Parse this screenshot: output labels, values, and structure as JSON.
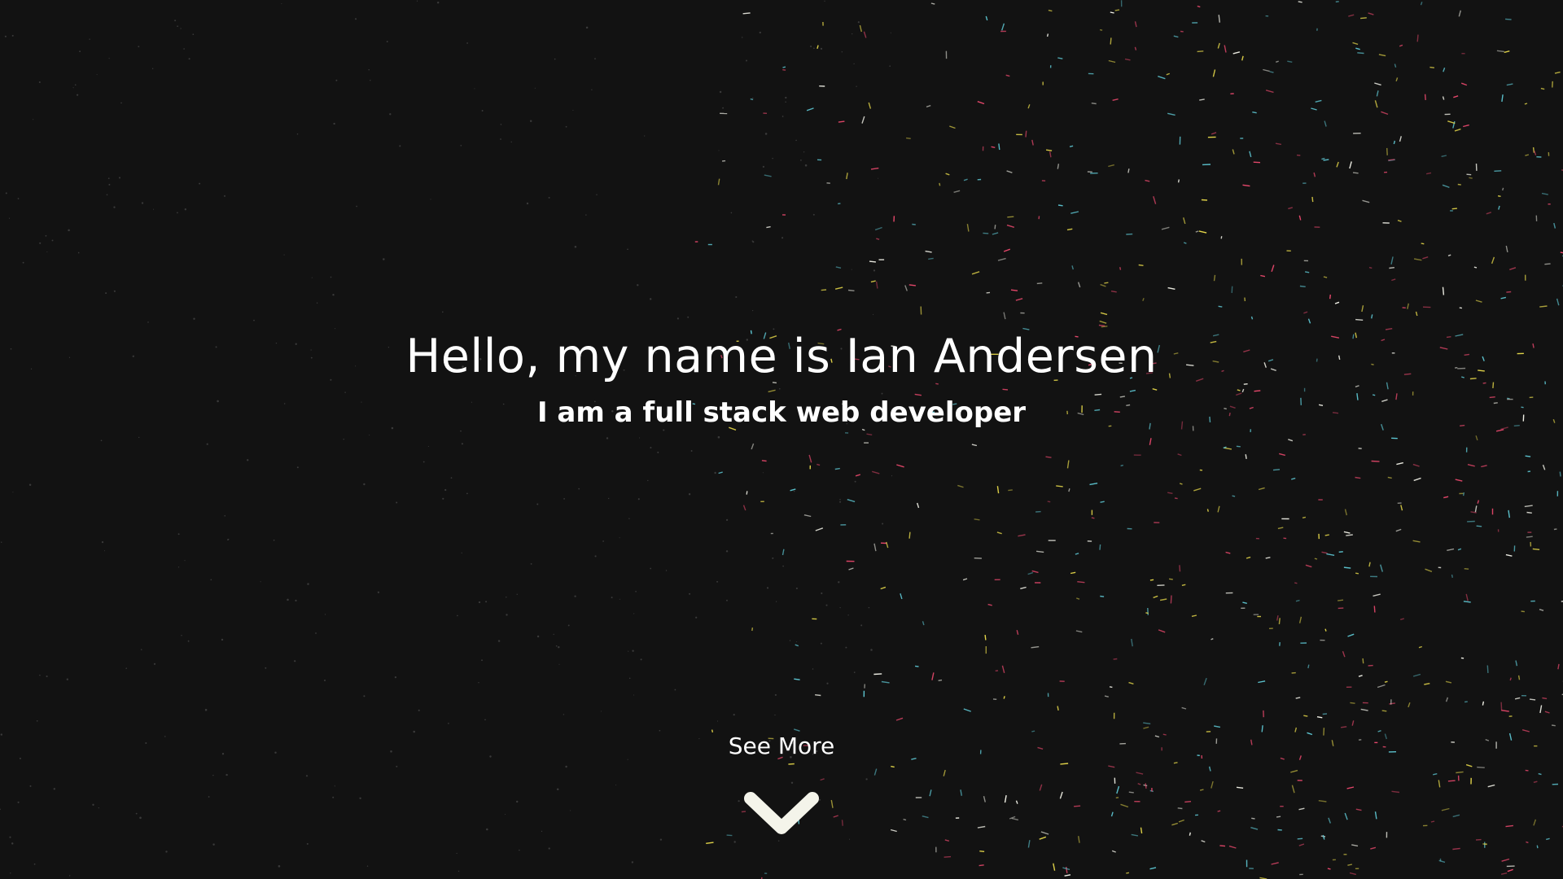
{
  "hero": {
    "headline": "Hello, my name is Ian Andersen",
    "subheadline": "I am a full stack web developer"
  },
  "see_more": {
    "label": "See More",
    "icon": "chevron-down-icon"
  },
  "colors": {
    "background": "#121212",
    "text": "#ffffff",
    "particles": [
      "#e8486c",
      "#5ec8d4",
      "#e6d84a",
      "#f4f4ea"
    ]
  }
}
